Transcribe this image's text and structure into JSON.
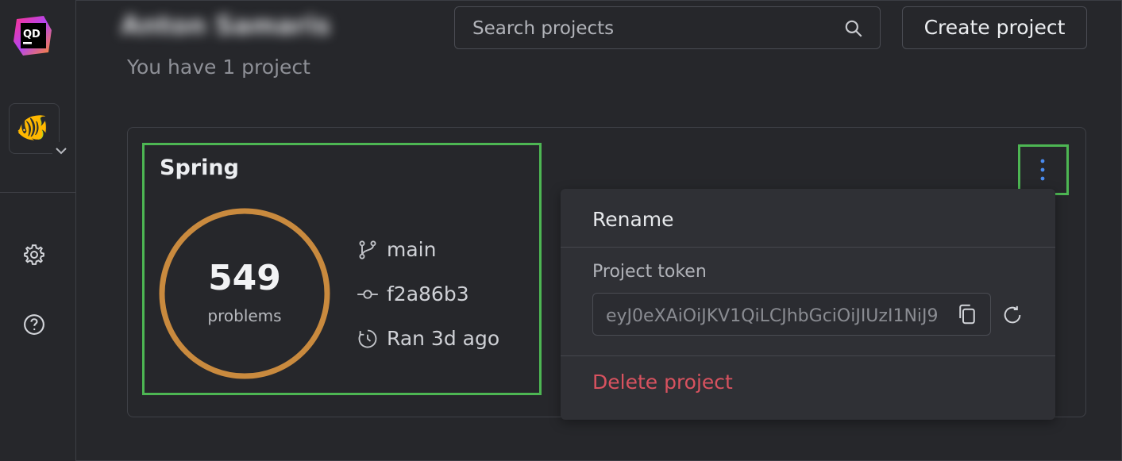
{
  "app": {
    "logo_text": "QD"
  },
  "sidebar": {
    "avatar_icon": "fish-emoji",
    "settings_icon": "gear-icon",
    "help_icon": "help-circle-icon"
  },
  "header": {
    "user_name": "Anton Samaris",
    "subtitle": "You have 1 project",
    "search_placeholder": "Search projects",
    "create_button": "Create project"
  },
  "project": {
    "name": "Spring",
    "problems_count": "549",
    "problems_label": "problems",
    "branch": "main",
    "commit": "f2a86b3",
    "last_run": "Ran 3d ago",
    "ring_color": "#c98a3e"
  },
  "menu": {
    "rename": "Rename",
    "token_label": "Project token",
    "token_value": "eyJ0eXAiOiJKV1QiLCJhbGciOiJIUzI1NiJ9",
    "delete": "Delete project",
    "delete_color": "#d8525f"
  },
  "highlight_color": "#4db653"
}
